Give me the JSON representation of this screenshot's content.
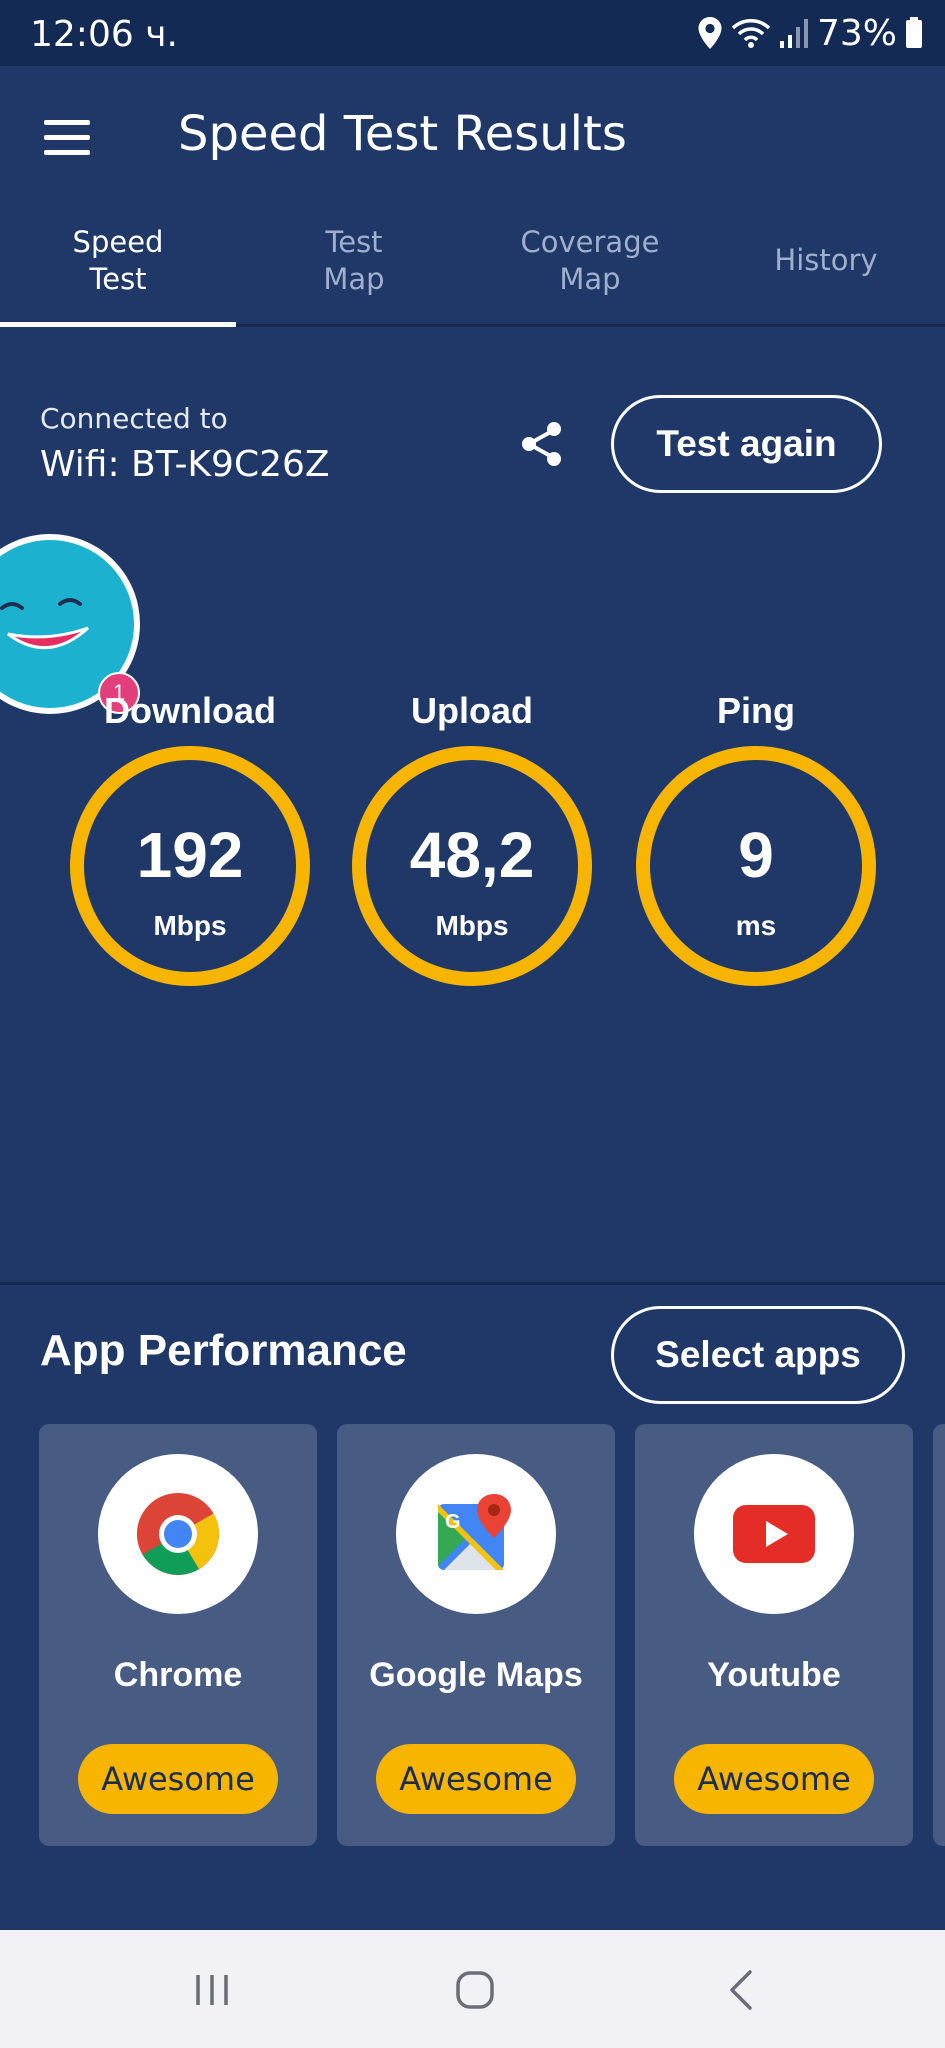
{
  "status_bar": {
    "time": "12:06 ч.",
    "battery": "73%",
    "icons": [
      "location-icon",
      "wifi-icon",
      "signal-icon",
      "battery-icon"
    ]
  },
  "header": {
    "title": "Speed Test Results"
  },
  "tabs": [
    {
      "label": "Speed\nTest",
      "active": true
    },
    {
      "label": "Test\nMap",
      "active": false
    },
    {
      "label": "Coverage\nMap",
      "active": false
    },
    {
      "label": "History",
      "active": false
    }
  ],
  "connection": {
    "label": "Connected to",
    "value": "Wifi: BT-K9C26Z"
  },
  "actions": {
    "test_again": "Test again",
    "share_icon": "share-icon"
  },
  "mascot": {
    "badge": "1"
  },
  "metrics": [
    {
      "label": "Download",
      "value": "192",
      "unit": "Mbps"
    },
    {
      "label": "Upload",
      "value": "48,2",
      "unit": "Mbps"
    },
    {
      "label": "Ping",
      "value": "9",
      "unit": "ms"
    }
  ],
  "app_performance": {
    "title": "App Performance",
    "select_label": "Select apps",
    "apps": [
      {
        "name": "Chrome",
        "rating": "Awesome",
        "icon": "chrome-icon"
      },
      {
        "name": "Google Maps",
        "rating": "Awesome",
        "icon": "google-maps-icon"
      },
      {
        "name": "Youtube",
        "rating": "Awesome",
        "icon": "youtube-icon"
      }
    ]
  },
  "colors": {
    "background": "#1f3868",
    "status_bar": "#132a55",
    "accent": "#f7b500",
    "card": "#475b83",
    "badge": "#e43f7d"
  }
}
